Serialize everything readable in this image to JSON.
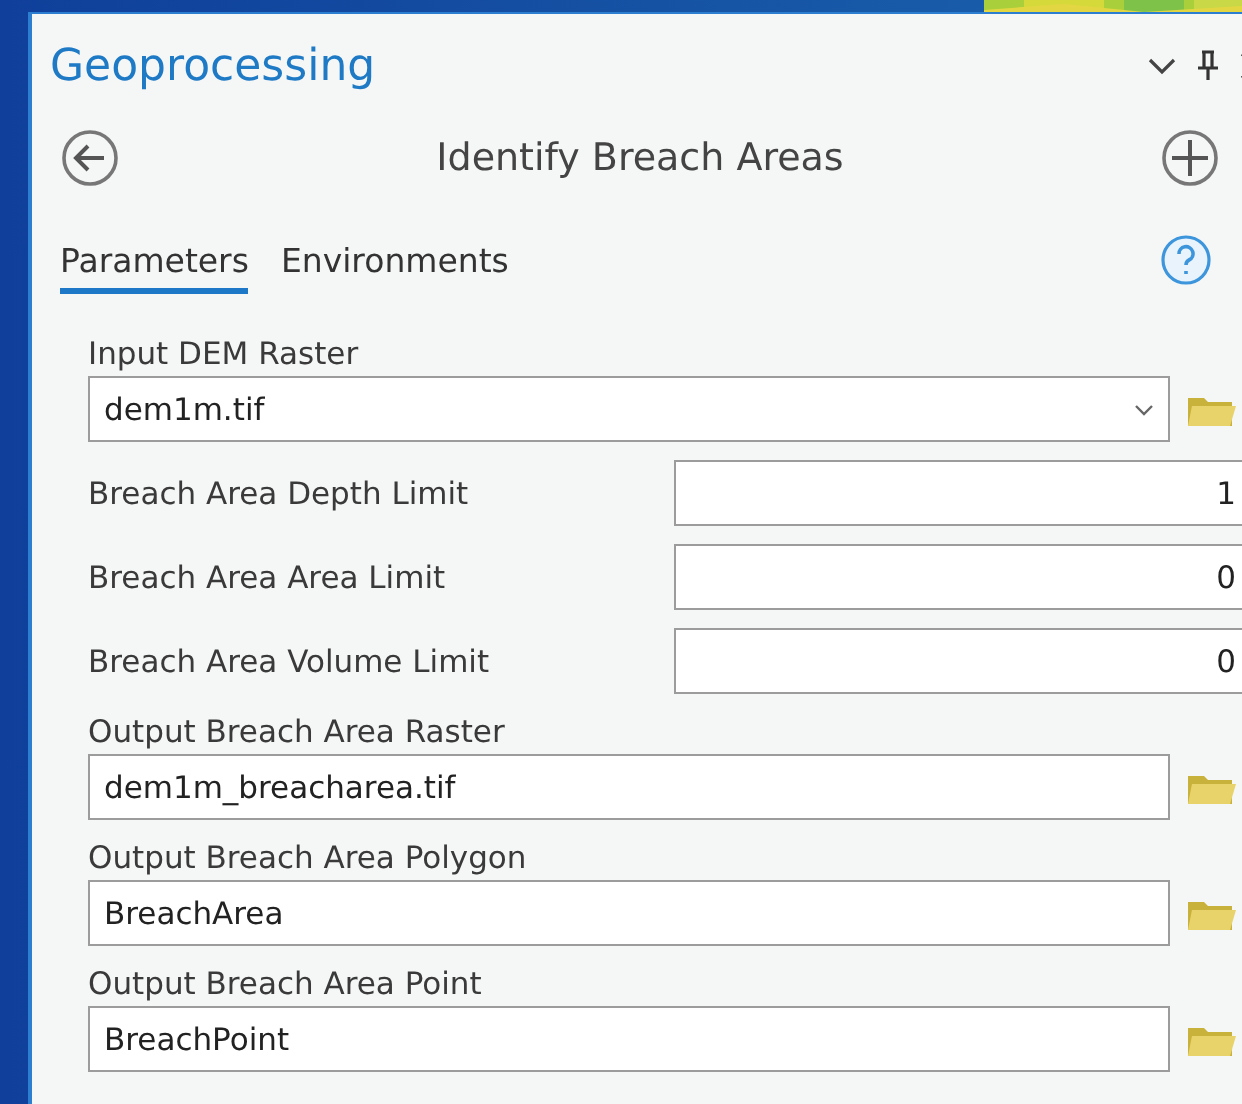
{
  "pane": {
    "title": "Geoprocessing"
  },
  "tool": {
    "title": "Identify Breach Areas"
  },
  "tabs": [
    {
      "label": "Parameters",
      "selected": true
    },
    {
      "label": "Environments",
      "selected": false
    }
  ],
  "parameters": [
    {
      "kind": "dropdown",
      "label": "Input DEM Raster",
      "value": "dem1m.tif"
    },
    {
      "kind": "number",
      "label": "Breach Area Depth Limit",
      "value": "1"
    },
    {
      "kind": "number",
      "label": "Breach Area Area Limit",
      "value": "0"
    },
    {
      "kind": "number",
      "label": "Breach Area Volume Limit",
      "value": "0"
    },
    {
      "kind": "file",
      "label": "Output Breach Area Raster",
      "value": "dem1m_breacharea.tif"
    },
    {
      "kind": "file",
      "label": "Output Breach Area Polygon",
      "value": "BreachArea"
    },
    {
      "kind": "file",
      "label": "Output Breach Area Point",
      "value": "BreachPoint"
    }
  ]
}
